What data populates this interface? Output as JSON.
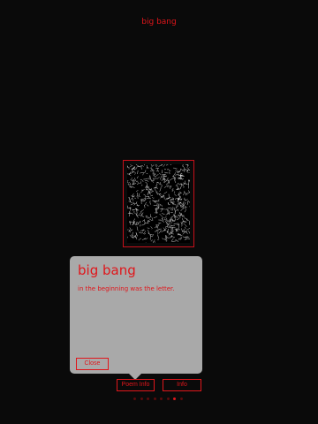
{
  "header": {
    "title": "big bang"
  },
  "artwork": {
    "description_icon": "scribble-artwork-image"
  },
  "popover": {
    "title": "big bang",
    "body": "in the beginning was the letter.",
    "close_label": "Close"
  },
  "tabs": {
    "poem_info_label": "Poem Info",
    "info_label": "Info"
  },
  "pagination": {
    "total_pages": 8,
    "current_page": 7
  },
  "colors": {
    "background": "#0a0a0a",
    "accent": "#e0161b",
    "popover_background": "#a9a9a9",
    "dot_inactive": "#5a0a0c"
  }
}
